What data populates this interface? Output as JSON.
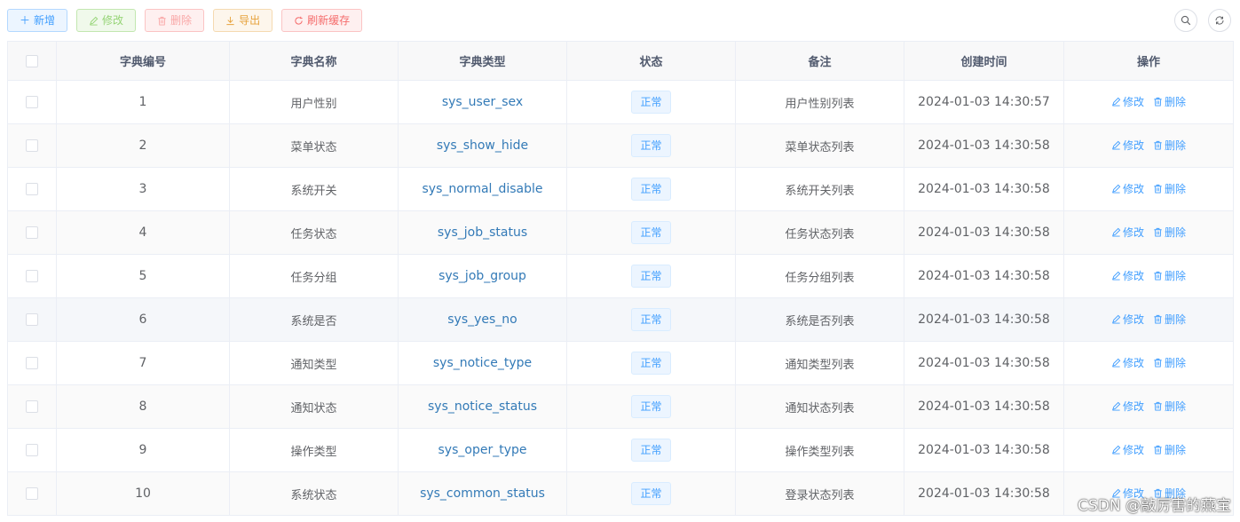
{
  "toolbar": {
    "add": "新增",
    "edit": "修改",
    "delete": "删除",
    "export": "导出",
    "refresh_cache": "刷新缓存"
  },
  "table": {
    "columns": [
      "字典编号",
      "字典名称",
      "字典类型",
      "状态",
      "备注",
      "创建时间",
      "操作"
    ],
    "edit_label": "修改",
    "delete_label": "删除",
    "rows": [
      {
        "id": "1",
        "name": "用户性别",
        "type": "sys_user_sex",
        "status": "正常",
        "remark": "用户性别列表",
        "created": "2024-01-03 14:30:57"
      },
      {
        "id": "2",
        "name": "菜单状态",
        "type": "sys_show_hide",
        "status": "正常",
        "remark": "菜单状态列表",
        "created": "2024-01-03 14:30:58"
      },
      {
        "id": "3",
        "name": "系统开关",
        "type": "sys_normal_disable",
        "status": "正常",
        "remark": "系统开关列表",
        "created": "2024-01-03 14:30:58"
      },
      {
        "id": "4",
        "name": "任务状态",
        "type": "sys_job_status",
        "status": "正常",
        "remark": "任务状态列表",
        "created": "2024-01-03 14:30:58"
      },
      {
        "id": "5",
        "name": "任务分组",
        "type": "sys_job_group",
        "status": "正常",
        "remark": "任务分组列表",
        "created": "2024-01-03 14:30:58"
      },
      {
        "id": "6",
        "name": "系统是否",
        "type": "sys_yes_no",
        "status": "正常",
        "remark": "系统是否列表",
        "created": "2024-01-03 14:30:58"
      },
      {
        "id": "7",
        "name": "通知类型",
        "type": "sys_notice_type",
        "status": "正常",
        "remark": "通知类型列表",
        "created": "2024-01-03 14:30:58"
      },
      {
        "id": "8",
        "name": "通知状态",
        "type": "sys_notice_status",
        "status": "正常",
        "remark": "通知状态列表",
        "created": "2024-01-03 14:30:58"
      },
      {
        "id": "9",
        "name": "操作类型",
        "type": "sys_oper_type",
        "status": "正常",
        "remark": "操作类型列表",
        "created": "2024-01-03 14:30:58"
      },
      {
        "id": "10",
        "name": "系统状态",
        "type": "sys_common_status",
        "status": "正常",
        "remark": "登录状态列表",
        "created": "2024-01-03 14:30:58"
      }
    ]
  },
  "watermark": "CSDN @敲厉害的燕宝",
  "icons": {
    "search": "search-icon",
    "refresh": "refresh-icon"
  },
  "colors": {
    "primary": "#409eff",
    "success": "#67c23a",
    "danger": "#f56c6c",
    "warning": "#e6a23c"
  }
}
